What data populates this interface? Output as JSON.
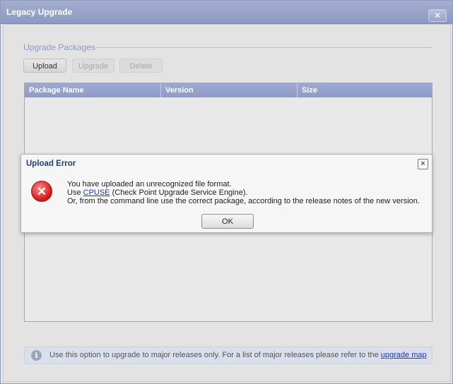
{
  "window": {
    "title": "Legacy Upgrade",
    "close_label": "×"
  },
  "section": {
    "title": "Upgrade Packages"
  },
  "toolbar": {
    "upload_label": "Upload",
    "upgrade_label": "Upgrade",
    "delete_label": "Delete"
  },
  "table": {
    "columns": [
      "Package Name",
      "Version",
      "Size"
    ]
  },
  "info": {
    "text": "Use this option to upgrade to major releases only. For a list of major releases please refer to the",
    "link": "upgrade map"
  },
  "dialog": {
    "title": "Upload Error",
    "close_label": "×",
    "line1": "You have uploaded an unrecognized file format.",
    "line2_prefix": "Use ",
    "line2_link": "CPUSE",
    "line2_suffix": " (Check Point Upgrade Service Engine).",
    "line3": "Or, from the command line use the correct package, according to the release notes of the new version.",
    "ok_label": "OK"
  },
  "icons": {
    "info": "info-icon",
    "error": "error-icon"
  }
}
